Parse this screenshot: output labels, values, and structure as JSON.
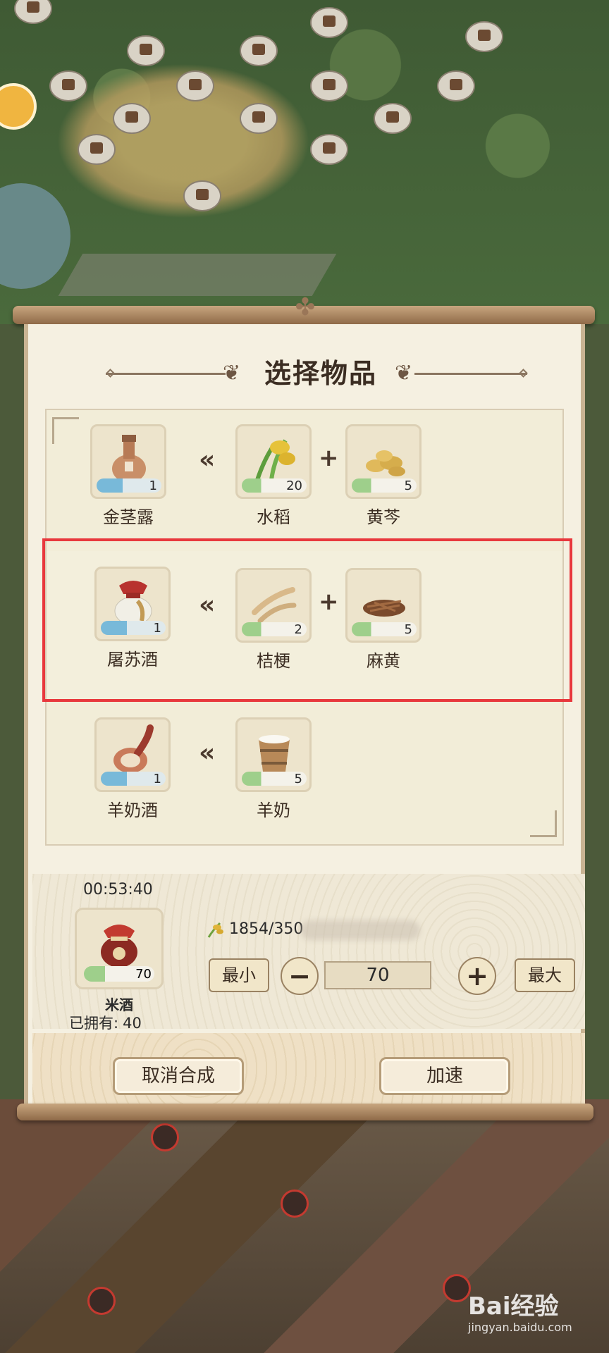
{
  "dialog": {
    "title": "选择物品"
  },
  "recipes": [
    {
      "result": {
        "name": "金茎露",
        "qty": "1"
      },
      "ingredients": [
        {
          "name": "水稻",
          "qty": "20"
        },
        {
          "name": "黄芩",
          "qty": "5"
        }
      ]
    },
    {
      "result": {
        "name": "屠苏酒",
        "qty": "1"
      },
      "ingredients": [
        {
          "name": "桔梗",
          "qty": "2"
        },
        {
          "name": "麻黄",
          "qty": "5"
        }
      ],
      "selected": true
    },
    {
      "result": {
        "name": "羊奶酒",
        "qty": "1"
      },
      "ingredients": [
        {
          "name": "羊奶",
          "qty": "5"
        }
      ]
    }
  ],
  "craft": {
    "timer": "00:53:40",
    "item_name": "米酒",
    "item_qty": "70",
    "owned_label": "已拥有:",
    "owned_value": "40",
    "cost_text": "1854/350",
    "min_label": "最小",
    "max_label": "最大",
    "minus_symbol": "−",
    "plus_symbol": "+",
    "quantity": "70"
  },
  "footer": {
    "cancel_label": "取消合成",
    "speedup_label": "加速"
  },
  "watermark": {
    "text": "Bai经验",
    "url": "jingyan.baidu.com"
  },
  "colors": {
    "selection_frame": "#e8383d",
    "panel_bg": "#f5f0e1",
    "accent_brown": "#3b2d22"
  }
}
